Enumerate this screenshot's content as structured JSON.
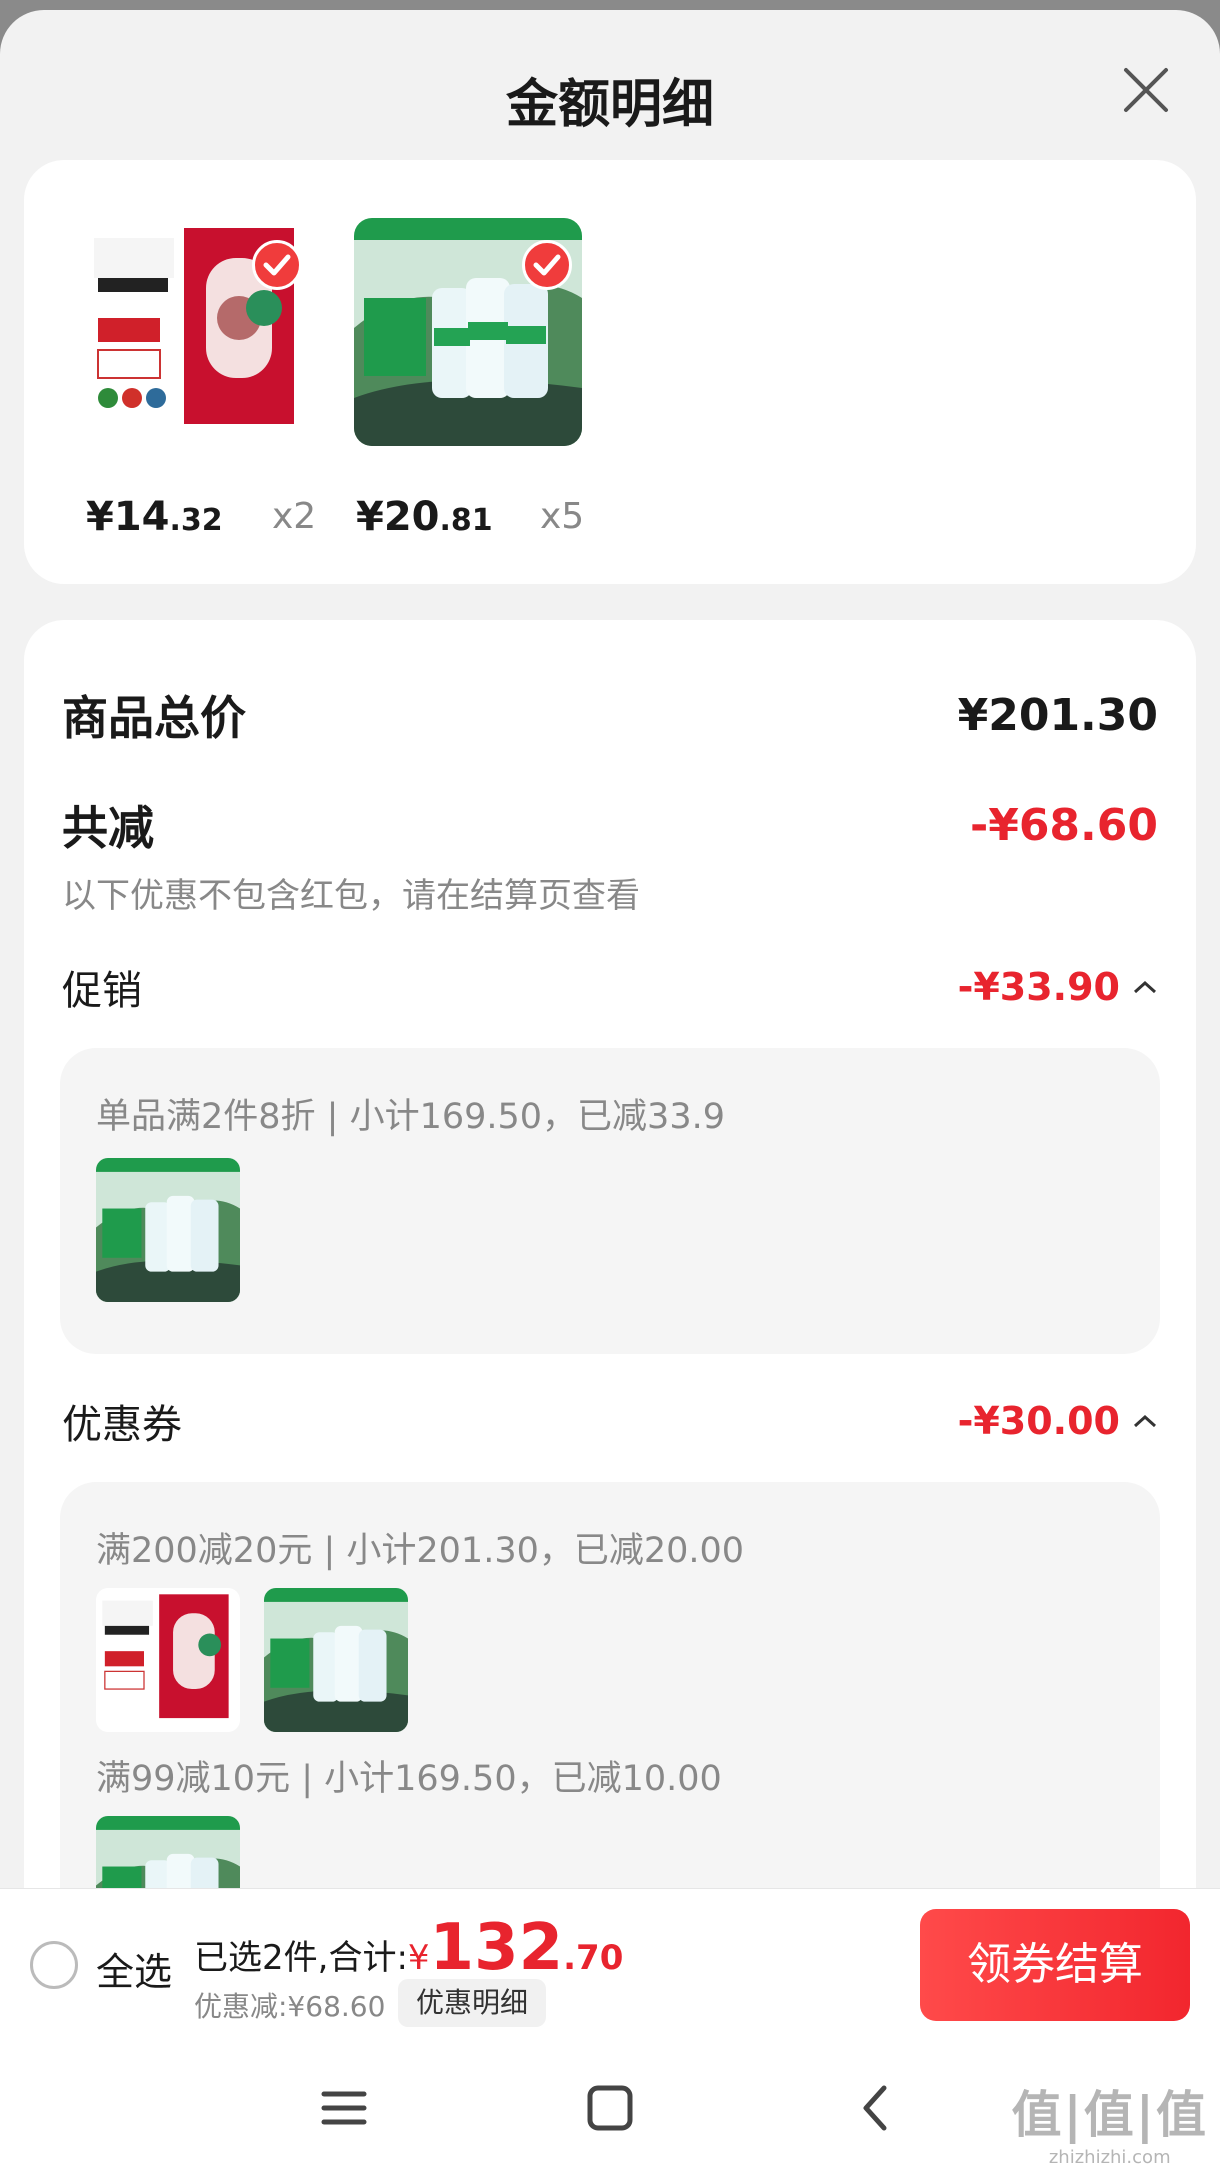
{
  "header": {
    "title": "金额明细",
    "close_icon": "close-icon"
  },
  "products": [
    {
      "price_int": "¥14",
      "price_dec": ".32",
      "qty": "x2",
      "checked": true
    },
    {
      "price_int": "¥20",
      "price_dec": ".81",
      "qty": "x5",
      "checked": true
    }
  ],
  "summary_card": {
    "total_label": "商品总价",
    "total_value": "¥201.30",
    "reduce_label": "共减",
    "reduce_value": "-¥68.60",
    "note": "以下优惠不包含红包，请在结算页查看",
    "promo": {
      "label": "促销",
      "value": "-¥33.90",
      "lines": [
        "单品满2件8折 | 小计169.50，已减33.9"
      ]
    },
    "coupon": {
      "label": "优惠券",
      "value": "-¥30.00",
      "lines": [
        "满200减20元 | 小计201.30，已减20.00",
        "满99减10元 | 小计169.50，已减10.00"
      ]
    }
  },
  "bottom_bar": {
    "select_all": "全选",
    "selected_text": "已选2件,合计:",
    "currency": "¥",
    "total_int": "132",
    "total_dec": ".70",
    "discount_text": "优惠减:¥68.60",
    "detail_button": "优惠明细",
    "checkout_button": "领券结算"
  },
  "colors": {
    "accent": "#e8242e",
    "background": "#f2f2f2"
  },
  "navbar": {
    "icons": [
      "menu-icon",
      "home-square-icon",
      "back-icon"
    ]
  },
  "watermark": {
    "mark": "值|值|值",
    "url": "zhizhizhi.com"
  }
}
